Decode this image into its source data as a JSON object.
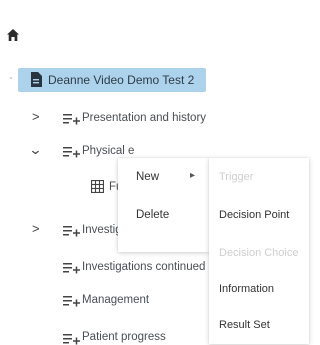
{
  "tree": {
    "home_icon": "home-icon",
    "root": {
      "label": "Deanne Video Demo Test 2",
      "icon": "document-icon"
    },
    "items": [
      {
        "label": "Presentation and history",
        "expander": ">",
        "icon": "list-add-icon"
      },
      {
        "label": "Physical examination",
        "visible_label": "Physical e",
        "expander": "⌄",
        "icon": "list-add-icon"
      },
      {
        "label": "Fu",
        "icon": "table-icon"
      },
      {
        "label": "Investigati",
        "expander": ">",
        "icon": "list-add-icon"
      },
      {
        "label": "Investigations continued",
        "icon": "list-add-icon"
      },
      {
        "label": "Management",
        "icon": "list-add-icon"
      },
      {
        "label": "Patient progress",
        "icon": "list-add-icon"
      }
    ]
  },
  "context_menu": {
    "items": [
      {
        "label": "New",
        "submenu_arrow": "▸"
      },
      {
        "label": "Delete"
      }
    ]
  },
  "submenu": {
    "items": [
      {
        "label": "Trigger",
        "enabled": false
      },
      {
        "label": "Decision Point",
        "enabled": true
      },
      {
        "label": "Decision Choice",
        "enabled": false
      },
      {
        "label": "Information",
        "enabled": true
      },
      {
        "label": "Result Set",
        "enabled": true
      }
    ]
  },
  "colors": {
    "selected_bg": "#add2ec",
    "disabled_text": "#cfcfcf",
    "text": "#3a3f44"
  }
}
